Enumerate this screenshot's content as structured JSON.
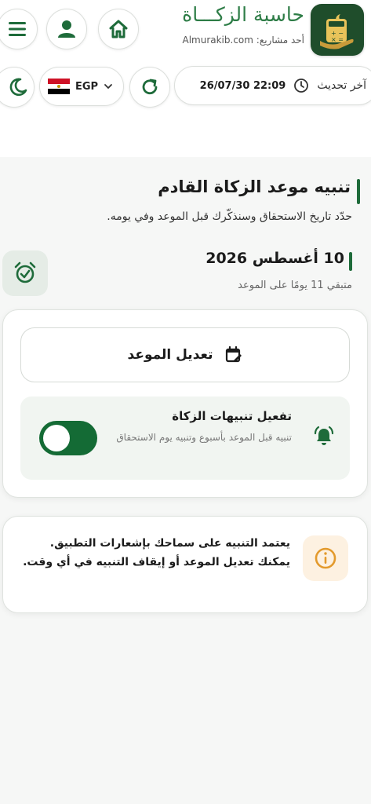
{
  "header": {
    "app_title": "حاسبة الزكـــاة",
    "subtitle_prefix": "أحد مشاريع:",
    "subtitle_site": "Almurakib.com",
    "logo_icon": "calculator-coins-icon",
    "buttons": {
      "home_icon": "home-icon",
      "profile_icon": "user-icon",
      "menu_icon": "menu-icon"
    }
  },
  "toolbar": {
    "last_update_label": "آخر تحديث",
    "last_update_value": "26/07/30 22:09",
    "clock_icon": "clock-icon",
    "refresh_icon": "refresh-icon",
    "currency_code": "EGP",
    "currency_flag": "egypt-flag-icon",
    "theme_icon": "moon-icon"
  },
  "reminder": {
    "title": "تنبيه موعد الزكاة القادم",
    "description": "حدّد تاريخ الاستحقاق وسنذكّرك قبل الموعد وفي يومه.",
    "date": "10 أغسطس 2026",
    "remaining": "متبقي 11 يومًا على الموعد"
  },
  "card": {
    "edit_label": "تعديل الموعد",
    "alerts_title": "تفعيل تنبيهات الزكاة",
    "alerts_desc": "تنبيه قبل الموعد بأسبوع وتنبيه يوم الاستحقاق",
    "alerts_enabled": true
  },
  "info": {
    "text": "يعتمد التنبيه على سماحك بإشعارات التطبيق. يمكنك تعديل الموعد أو إيقاف التنبيه في أي وقت."
  },
  "colors": {
    "brand_green": "#1e6b3a",
    "toggle_on": "#146b35",
    "title_green": "#2e7d47",
    "info_orange": "#e39a2c"
  }
}
